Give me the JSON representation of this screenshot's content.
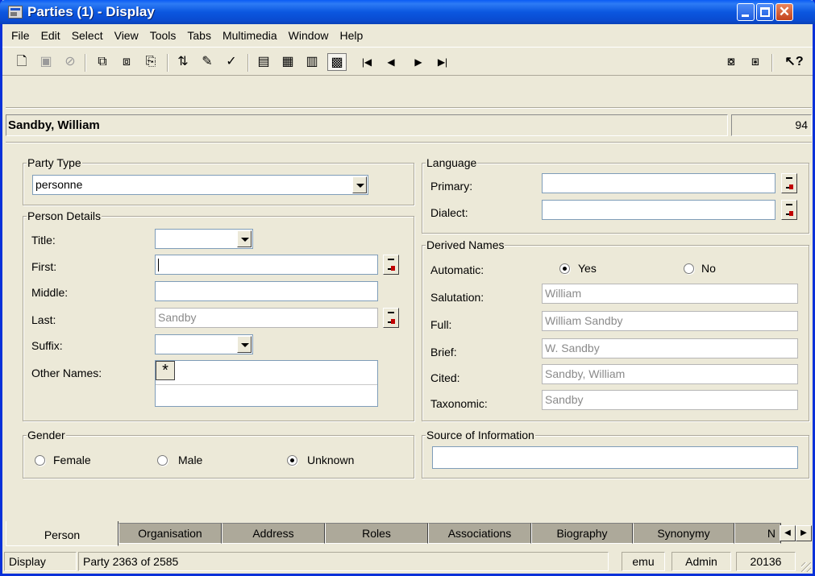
{
  "window": {
    "title": "Parties (1) - Display",
    "controls": [
      "minimize",
      "maximize",
      "close"
    ]
  },
  "menu": [
    "File",
    "Edit",
    "Select",
    "View",
    "Tools",
    "Tabs",
    "Multimedia",
    "Window",
    "Help"
  ],
  "toolbar": {
    "icons": [
      "new-record-icon",
      "save-icon",
      "cancel-icon",
      "search-icon",
      "find-icon",
      "report-icon",
      "sort-icon",
      "edit-icon",
      "spellcheck-icon",
      "details-view-icon",
      "list-view-icon",
      "page-view-icon",
      "display-view-icon",
      "first-record-icon",
      "previous-record-icon",
      "next-record-icon",
      "last-record-icon",
      "attach-icon",
      "copy-icon",
      "help-pointer-icon"
    ]
  },
  "record": {
    "name": "Sandby, William",
    "number": "94"
  },
  "party_type": {
    "legend": "Party Type",
    "value": "personne"
  },
  "person_details": {
    "legend": "Person Details",
    "title_label": "Title:",
    "title_value": "",
    "first_label": "First:",
    "first_value": "",
    "middle_label": "Middle:",
    "middle_value": "",
    "last_label": "Last:",
    "last_value": "Sandby",
    "suffix_label": "Suffix:",
    "suffix_value": "",
    "other_names_label": "Other Names:",
    "other_names_marker": "*"
  },
  "gender": {
    "legend": "Gender",
    "options": [
      "Female",
      "Male",
      "Unknown"
    ],
    "selected": "Unknown"
  },
  "language": {
    "legend": "Language",
    "primary_label": "Primary:",
    "primary_value": "",
    "dialect_label": "Dialect:",
    "dialect_value": ""
  },
  "derived_names": {
    "legend": "Derived Names",
    "automatic_label": "Automatic:",
    "yes_label": "Yes",
    "no_label": "No",
    "selected": "Yes",
    "salutation_label": "Salutation:",
    "salutation_value": "William",
    "full_label": "Full:",
    "full_value": "William Sandby",
    "brief_label": "Brief:",
    "brief_value": "W. Sandby",
    "cited_label": "Cited:",
    "cited_value": "Sandby, William",
    "taxonomic_label": "Taxonomic:",
    "taxonomic_value": "Sandby"
  },
  "source": {
    "legend": "Source of Information",
    "value": ""
  },
  "tabs": [
    "Person",
    "Organisation",
    "Address",
    "Roles",
    "Associations",
    "Biography",
    "Synonymy",
    "N"
  ],
  "active_tab": "Person",
  "status": {
    "mode": "Display",
    "position": "Party 2363 of 2585",
    "user": "emu",
    "group": "Admin",
    "id": "20136"
  },
  "colors": {
    "title_bar": "#0b57e0",
    "face": "#ece9d8",
    "close_button": "#c2421d"
  }
}
